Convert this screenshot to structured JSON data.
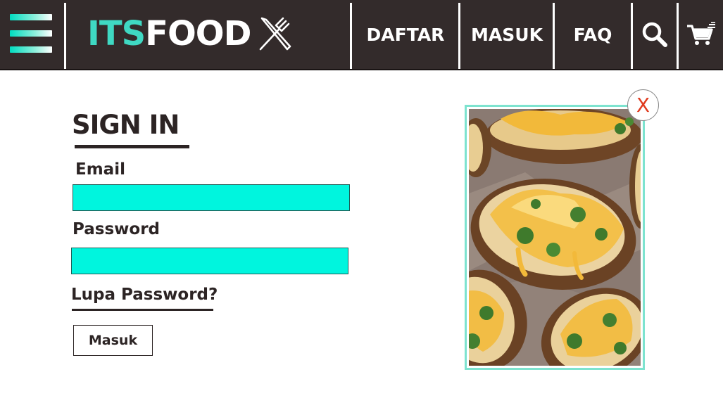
{
  "brand": {
    "part1": "ITS",
    "part2": "FOOD"
  },
  "nav": {
    "daftar": "DAFTAR",
    "masuk": "MASUK",
    "faq": "FAQ"
  },
  "icons": {
    "menu": "hamburger-menu-icon",
    "logo": "fork-knife-icon",
    "search": "search-icon",
    "cart": "cart-icon",
    "close": "close-icon"
  },
  "form": {
    "title": "SIGN IN",
    "email_label": "Email",
    "email_value": "",
    "password_label": "Password",
    "password_value": "",
    "forgot_link": "Lupa Password?",
    "submit_label": "Masuk"
  },
  "popup": {
    "close_label": "X"
  },
  "colors": {
    "nav_bg": "#332b2b",
    "accent": "#3fd9c3",
    "field_bg": "#00f5de",
    "text": "#2c2424",
    "close": "#e03a1e"
  }
}
